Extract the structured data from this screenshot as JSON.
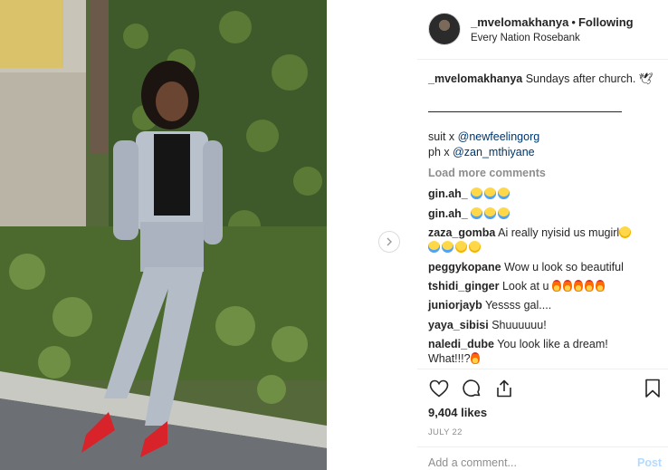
{
  "header": {
    "username": "_mvelomakhanya",
    "separator": "•",
    "follow_label": "Following",
    "location": "Every Nation Rosebank"
  },
  "caption": {
    "username": "_mvelomakhanya",
    "text": "Sundays after church. 🕊",
    "line1_prefix": "suit x ",
    "line1_mention": "@newfeelingorg",
    "line2_prefix": "ph x ",
    "line2_mention": "@zan_mthiyane"
  },
  "load_more": "Load more comments",
  "comments": [
    {
      "user": "gin.ah_",
      "text": "",
      "emoji": [
        "cry",
        "cry",
        "cry"
      ]
    },
    {
      "user": "gin.ah_",
      "text": "",
      "emoji": [
        "cry",
        "cry",
        "cry"
      ]
    },
    {
      "user": "zaza_gomba",
      "text": "Ai really nyisid us mugirl",
      "emoji": [
        "tongue"
      ],
      "line2_emoji": [
        "cry",
        "cry",
        "tongue",
        "tongue"
      ]
    },
    {
      "user": "peggykopane",
      "text": "Wow u look so beautiful"
    },
    {
      "user": "tshidi_ginger",
      "text": "Look at u",
      "emoji": [
        "fire",
        "fire",
        "fire",
        "fire",
        "fire"
      ]
    },
    {
      "user": "juniorjayb",
      "text": "Yessss gal...."
    },
    {
      "user": "yaya_sibisi",
      "text": "Shuuuuuu!"
    },
    {
      "user": "naledi_dube",
      "text": "You look like a dream!",
      "line2": "What!!!?",
      "line2_emoji": [
        "fire"
      ]
    }
  ],
  "actions": {
    "like_icon": "heart-icon",
    "comment_icon": "comment-bubble-icon",
    "share_icon": "share-icon",
    "save_icon": "bookmark-icon"
  },
  "likes": "9,404 likes",
  "date": "JULY 22",
  "comment_input": {
    "placeholder": "Add a comment...",
    "post_label": "Post"
  },
  "photo": {
    "description_icon": "photo-post-image"
  }
}
